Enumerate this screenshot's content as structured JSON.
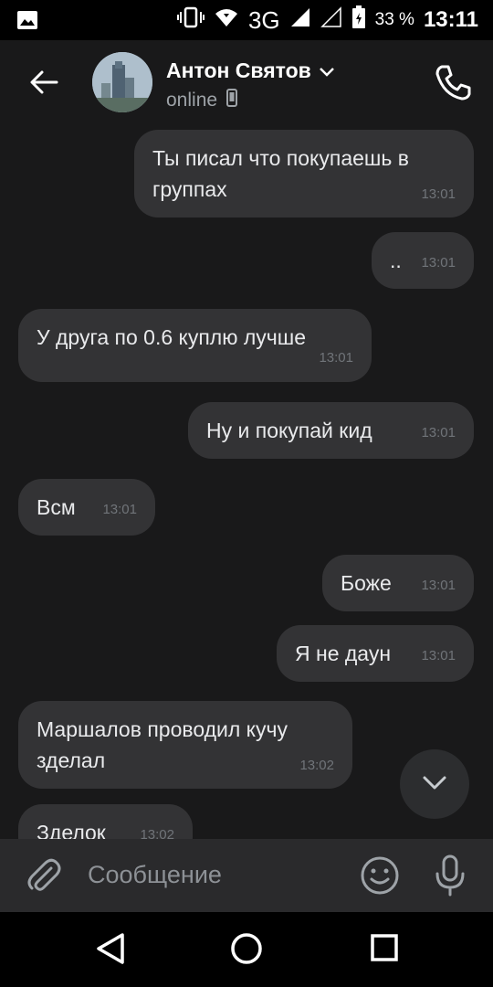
{
  "status_bar": {
    "battery_percent": "33 %",
    "network": "3G",
    "time": "13:11"
  },
  "header": {
    "contact_name": "Антон Святов",
    "presence": "online"
  },
  "messages": [
    {
      "direction": "outgoing",
      "text": "Ты писал что покупаешь в группах",
      "time": "13:01"
    },
    {
      "direction": "outgoing",
      "text": "..",
      "time": "13:01"
    },
    {
      "direction": "incoming",
      "text": "У друга по 0.6 куплю лучше",
      "time": "13:01"
    },
    {
      "direction": "outgoing",
      "text": "Ну и покупай кид",
      "time": "13:01"
    },
    {
      "direction": "incoming",
      "text": "Всм",
      "time": "13:01"
    },
    {
      "direction": "outgoing",
      "text": "Боже",
      "time": "13:01"
    },
    {
      "direction": "outgoing",
      "text": "Я не даун",
      "time": "13:01"
    },
    {
      "direction": "incoming",
      "text": "Маршалов проводил кучу зделал",
      "time": "13:02"
    },
    {
      "direction": "incoming",
      "text": "Зделок",
      "time": "13:02"
    }
  ],
  "composer": {
    "placeholder": "Сообщение"
  },
  "colors": {
    "background": "#19191a",
    "bubble": "#333335",
    "composer": "#2a2a2c"
  }
}
